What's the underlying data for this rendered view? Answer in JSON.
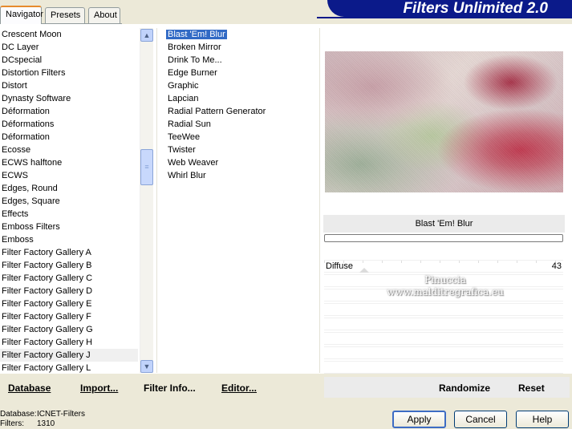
{
  "tabs": [
    {
      "label": "Navigator",
      "active": true
    },
    {
      "label": "Presets",
      "active": false
    },
    {
      "label": "About",
      "active": false
    }
  ],
  "banner_title": "Filters Unlimited 2.0",
  "categories": [
    "Crescent Moon",
    "DC Layer",
    "DCspecial",
    "Distortion Filters",
    "Distort",
    "Dynasty Software",
    "Déformation",
    "Déformations",
    "Déformation",
    "Ecosse",
    "ECWS halftone",
    "ECWS",
    "Edges, Round",
    "Edges, Square",
    "Effects",
    "Emboss Filters",
    "Emboss",
    "Filter Factory Gallery A",
    "Filter Factory Gallery B",
    "Filter Factory Gallery C",
    "Filter Factory Gallery D",
    "Filter Factory Gallery E",
    "Filter Factory Gallery F",
    "Filter Factory Gallery G",
    "Filter Factory Gallery H",
    "Filter Factory Gallery J",
    "Filter Factory Gallery L"
  ],
  "selected_category": "Filter Factory Gallery J",
  "filters": [
    "Blast 'Em! Blur",
    "Broken Mirror",
    "Drink To Me...",
    "Edge Burner",
    "Graphic",
    "Lapcian",
    "Radial Pattern Generator",
    "Radial Sun",
    "TeeWee",
    "Twister",
    "Web Weaver",
    "Whirl Blur"
  ],
  "selected_filter": "Blast 'Em! Blur",
  "filter_title": "Blast 'Em! Blur",
  "parameter": {
    "label": "Diffuse",
    "value": "43"
  },
  "watermark": {
    "line1": "Pinuccia",
    "line2": "www.malditregrafica.eu"
  },
  "toolbar": {
    "database": "Database",
    "import": "Import...",
    "filter_info": "Filter Info...",
    "editor": "Editor...",
    "randomize": "Randomize",
    "reset": "Reset"
  },
  "info": {
    "database_key": "Database:",
    "database_value": "ICNET-Filters",
    "filters_key": "Filters:",
    "filters_value": "1310"
  },
  "buttons": {
    "apply": "Apply",
    "cancel": "Cancel",
    "help": "Help"
  },
  "colors": {
    "banner": "#0b1a8a",
    "selection": "#316ac5",
    "tab_highlight": "#e68b2c"
  }
}
